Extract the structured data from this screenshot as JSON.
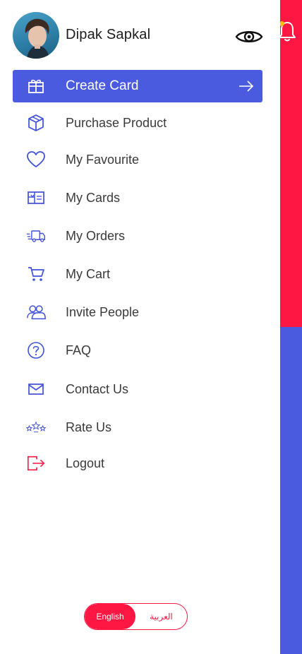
{
  "user": {
    "name": "Dipak Sapkal"
  },
  "menu": {
    "items": [
      {
        "label": "Create Card",
        "icon": "gift-card-icon",
        "active": true
      },
      {
        "label": "Purchase Product",
        "icon": "box-icon"
      },
      {
        "label": "My Favourite",
        "icon": "heart-icon"
      },
      {
        "label": "My Cards",
        "icon": "card-icon"
      },
      {
        "label": "My Orders",
        "icon": "delivery-truck-icon"
      },
      {
        "label": "My Cart",
        "icon": "cart-icon"
      },
      {
        "label": "Invite People",
        "icon": "people-icon"
      },
      {
        "label": "FAQ",
        "icon": "question-icon"
      },
      {
        "label": "Contact Us",
        "icon": "mail-icon"
      },
      {
        "label": "Rate Us",
        "icon": "stars-icon"
      },
      {
        "label": "Logout",
        "icon": "logout-icon"
      }
    ]
  },
  "language": {
    "english": "English",
    "arabic": "العربية",
    "selected": "English"
  },
  "colors": {
    "primary": "#4A5BE0",
    "accent": "#FF1744",
    "badge": "#FFC107"
  }
}
